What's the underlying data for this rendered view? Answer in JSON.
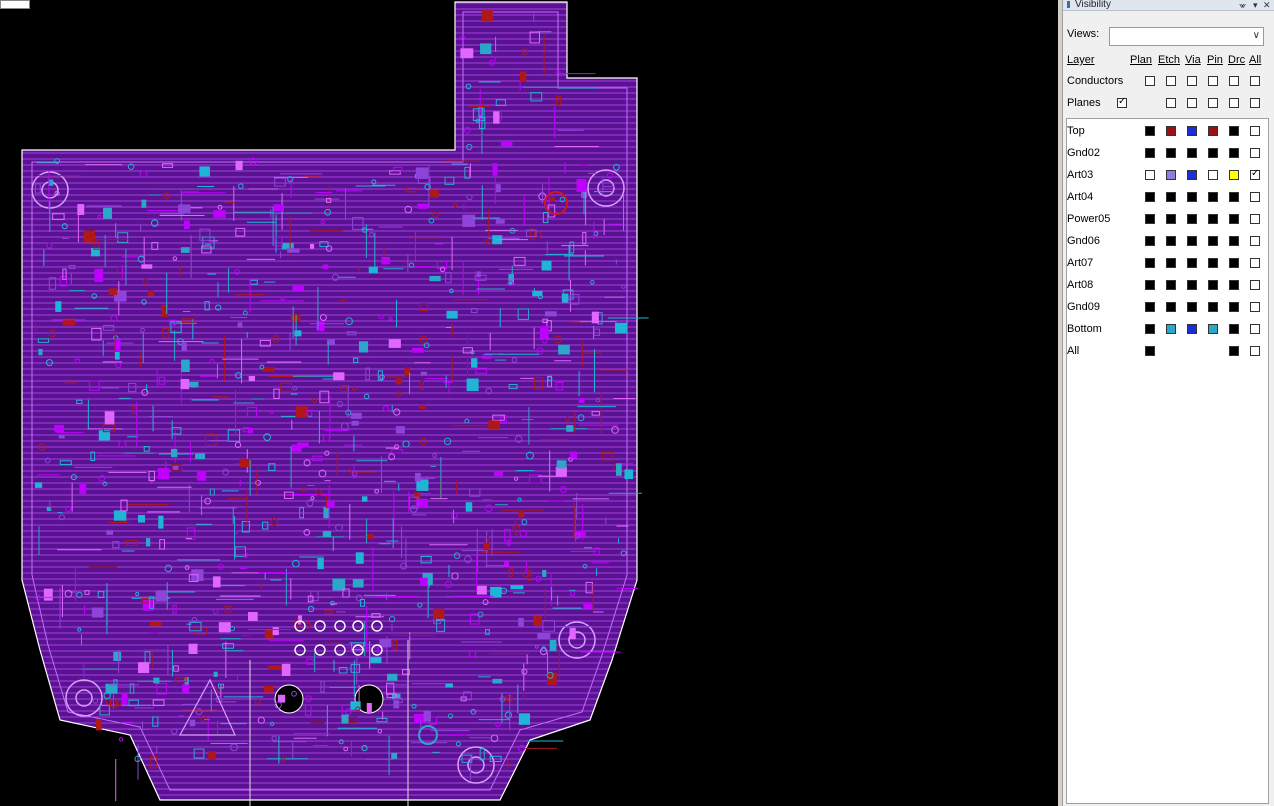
{
  "panel": {
    "title": "Visibility",
    "views_label": "Views:",
    "views_value": "",
    "columns": {
      "layer": "Layer",
      "plan": "Plan",
      "etch": "Etch",
      "via": "Via",
      "pin": "Pin",
      "drc": "Drc",
      "all": "All"
    },
    "summary": [
      {
        "label": "Conductors",
        "plan": false,
        "etch": false,
        "via": false,
        "pin": false,
        "drc": false,
        "all": false
      },
      {
        "label": "Planes",
        "plan": true,
        "etch": false,
        "via": false,
        "pin": false,
        "drc": false,
        "all": false
      }
    ],
    "layers": [
      {
        "name": "Top",
        "colors": [
          "#000000",
          "#9b1010",
          "#1a2dd6",
          "#9b1010",
          "#000000"
        ],
        "all": false
      },
      {
        "name": "Gnd02",
        "colors": [
          "#000000",
          "#000000",
          "#000000",
          "#000000",
          "#000000"
        ],
        "all": false
      },
      {
        "name": "Art03",
        "colors": [
          "#ffffff",
          "#8a7ee0",
          "#1a2dd6",
          "#ffffff",
          "#ffff00"
        ],
        "all": true
      },
      {
        "name": "Art04",
        "colors": [
          "#000000",
          "#000000",
          "#000000",
          "#000000",
          "#000000"
        ],
        "all": false
      },
      {
        "name": "Power05",
        "colors": [
          "#000000",
          "#000000",
          "#000000",
          "#000000",
          "#000000"
        ],
        "all": false
      },
      {
        "name": "Gnd06",
        "colors": [
          "#000000",
          "#000000",
          "#000000",
          "#000000",
          "#000000"
        ],
        "all": false
      },
      {
        "name": "Art07",
        "colors": [
          "#000000",
          "#000000",
          "#000000",
          "#000000",
          "#000000"
        ],
        "all": false
      },
      {
        "name": "Art08",
        "colors": [
          "#000000",
          "#000000",
          "#000000",
          "#000000",
          "#000000"
        ],
        "all": false
      },
      {
        "name": "Gnd09",
        "colors": [
          "#000000",
          "#000000",
          "#000000",
          "#000000",
          "#000000"
        ],
        "all": false
      },
      {
        "name": "Bottom",
        "colors": [
          "#000000",
          "#2aa7c9",
          "#1a2dd6",
          "#2aa7c9",
          "#000000"
        ],
        "all": false
      },
      {
        "name": "All",
        "colors": [
          "#000000",
          null,
          null,
          null,
          "#000000"
        ],
        "all": false
      }
    ]
  },
  "canvas": {
    "colors": {
      "background": "#000000",
      "etch_top": "#c000ff",
      "etch_bottom": "#1fb5d6",
      "plane": "#7a1fb5",
      "copper_red": "#b01818",
      "outline": "#ffffff",
      "via": "#2aa7c9"
    }
  }
}
